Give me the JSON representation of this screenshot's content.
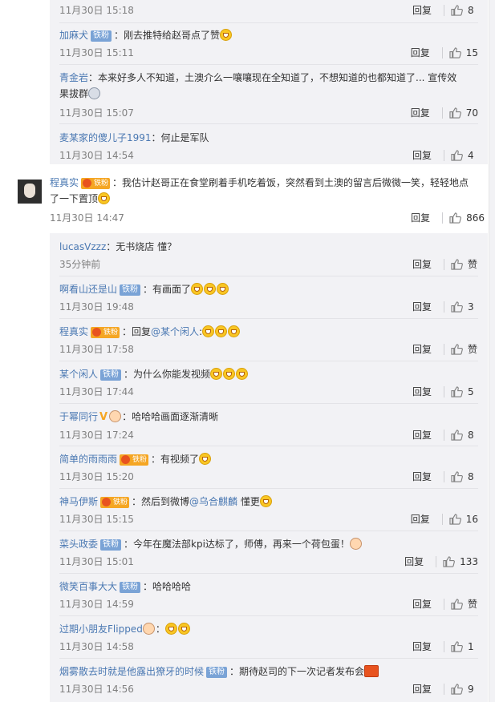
{
  "action_reply_label": "回复",
  "top_replies": [
    {
      "user": "",
      "fan": false,
      "text": "",
      "time": "11月30日 15:18",
      "likes": "8"
    },
    {
      "user": "加麻犬",
      "fan": true,
      "text": "：刚去推特给赵哥点了赞",
      "time": "11月30日 15:11",
      "likes": "15"
    },
    {
      "user": "青金岩",
      "fan": false,
      "text": "：本来好多人不知道，土澳介么一嚷嚷现在全知道了，不想知道的也都知道了... 宣传效",
      "text2": "果拔群",
      "time": "11月30日 15:07",
      "likes": "70"
    },
    {
      "user": "麦某家的傻儿子1991",
      "fan": false,
      "text": "：何止是军队",
      "time": "11月30日 14:54",
      "likes": "4"
    }
  ],
  "main_comment": {
    "user": "程真实",
    "text": "：我估计赵哥正在食堂刷着手机吃着饭，突然看到土澳的留言后微微一笑，轻轻地点",
    "text2": "了一下置顶",
    "time": "11月30日 14:47",
    "likes": "866"
  },
  "sub_replies": [
    {
      "user": "lucasVzzz",
      "text": "：无书烧店 懂？",
      "time": "35分钟前",
      "likes": "赞"
    },
    {
      "user": "啊看山还是山",
      "badge": "铁粉",
      "text": "：有画面了",
      "time": "11月30日 19:48",
      "likes": "3"
    },
    {
      "user": "程真实",
      "badge": "铁粉",
      "text": "：回复",
      "mention": "@某个闲人",
      "text_after": ":",
      "time": "11月30日 17:58",
      "likes": "赞"
    },
    {
      "user": "某个闲人",
      "badge": "铁粉",
      "text": "：为什么你能发视频",
      "time": "11月30日 17:44",
      "likes": "5"
    },
    {
      "user": "于幂同行",
      "text": "：哈哈哈画面逐渐清晰",
      "time": "11月30日 17:24",
      "likes": "8"
    },
    {
      "user": "简单的雨雨雨",
      "badge": "铁粉",
      "text": "：有视频了",
      "time": "11月30日 15:20",
      "likes": "8"
    },
    {
      "user": "神马伊斯",
      "badge": "铁粉",
      "text": "：然后到微博",
      "mention": "@乌合麒麟",
      "text_after": " 懂更",
      "time": "11月30日 15:15",
      "likes": "16"
    },
    {
      "user": "菜头政委",
      "badge": "铁粉",
      "text": "：今年在魔法部kpi达标了，师傅，再来一个荷包蛋！",
      "time": "11月30日 15:01",
      "likes": "133"
    },
    {
      "user": "微笑百事大大",
      "badge": "铁粉",
      "text": "：哈哈哈哈",
      "time": "11月30日 14:59",
      "likes": "赞"
    },
    {
      "user": "过期小朋友Flipped",
      "text": "：",
      "time": "11月30日 14:58",
      "likes": "1"
    },
    {
      "user": "烟雾散去时就是他露出獠牙的时候",
      "badge": "铁粉",
      "text": "：期待赵司的下一次记者发布会",
      "time": "11月30日 14:56",
      "likes": "9"
    }
  ]
}
